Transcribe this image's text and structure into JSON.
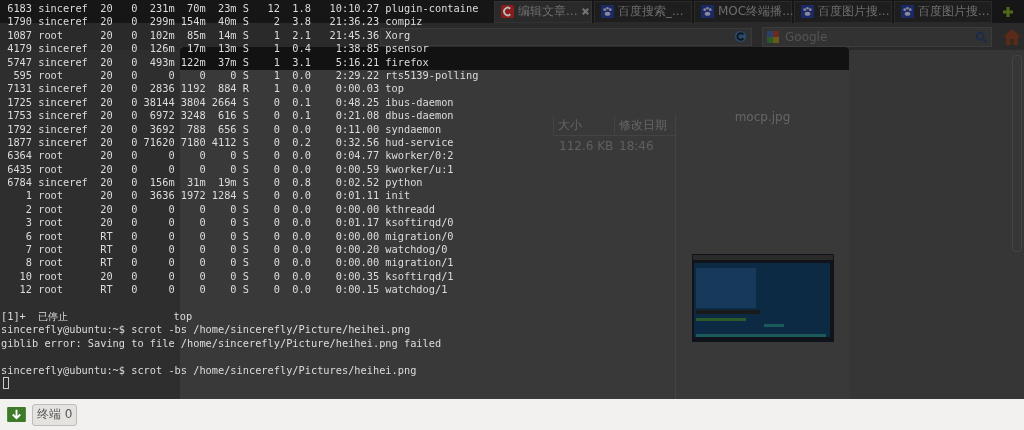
{
  "browser": {
    "tabs": [
      {
        "label": "编辑文章...",
        "kind": "arc",
        "selected": true
      },
      {
        "label": "百度搜索_...",
        "kind": "paw",
        "selected": false
      },
      {
        "label": "MOC终端播...",
        "kind": "paw",
        "selected": false
      },
      {
        "label": "百度图片搜...",
        "kind": "paw",
        "selected": false
      },
      {
        "label": "百度图片搜...",
        "kind": "paw",
        "selected": false
      }
    ],
    "search": {
      "placeholder": "Google"
    }
  },
  "file_manager": {
    "columns": [
      "大小",
      "修改日期"
    ],
    "row": [
      "112.6 KB",
      "18:46"
    ],
    "preview": {
      "title": "mocp.jpg"
    }
  },
  "terminal": {
    "process_rows": [
      " 6183 sinceref  20   0  231m  70m  23m S   12  1.8   10:10.27 plugin-containe",
      " 1790 sinceref  20   0  299m 154m  40m S    2  3.8   21:36.23 compiz",
      " 1087 root      20   0  102m  85m  14m S    1  2.1   21:45.36 Xorg",
      " 4179 sinceref  20   0  126m  17m  13m S    1  0.4    1:38.85 psensor",
      " 5747 sinceref  20   0  493m 122m  37m S    1  3.1    5:16.21 firefox",
      "  595 root      20   0     0    0    0 S    1  0.0    2:29.22 rts5139-polling",
      " 7131 sinceref  20   0  2836 1192  884 R    1  0.0    0:00.03 top",
      " 1725 sinceref  20   0 38144 3804 2664 S    0  0.1    0:48.25 ibus-daemon",
      " 1753 sinceref  20   0  6972 3248  616 S    0  0.1    0:21.08 dbus-daemon",
      " 1792 sinceref  20   0  3692  788  656 S    0  0.0    0:11.00 syndaemon",
      " 1877 sinceref  20   0 71620 7180 4112 S    0  0.2    0:32.56 hud-service",
      " 6364 root      20   0     0    0    0 S    0  0.0    0:04.77 kworker/0:2",
      " 6435 root      20   0     0    0    0 S    0  0.0    0:00.59 kworker/u:1",
      " 6784 sinceref  20   0  156m  31m  19m S    0  0.8    0:02.52 python",
      "    1 root      20   0  3636 1972 1284 S    0  0.0    0:01.11 init",
      "    2 root      20   0     0    0    0 S    0  0.0    0:00.00 kthreadd",
      "    3 root      20   0     0    0    0 S    0  0.0    0:01.17 ksoftirqd/0",
      "    6 root      RT   0     0    0    0 S    0  0.0    0:00.00 migration/0",
      "    7 root      RT   0     0    0    0 S    0  0.0    0:00.20 watchdog/0",
      "    8 root      RT   0     0    0    0 S    0  0.0    0:00.00 migration/1",
      "   10 root      20   0     0    0    0 S    0  0.0    0:00.35 ksoftirqd/1",
      "   12 root      RT   0     0    0    0 S    0  0.0    0:00.15 watchdog/1"
    ],
    "output_blocks": [
      [
        "[1]+  已停止                 top",
        "sincerefly@ubuntu:~$ scrot -bs /home/sincerefly/Picture/heihei.png",
        "giblib error: Saving to file /home/sincerefly/Picture/heihei.png failed"
      ],
      [
        "sincerefly@ubuntu:~$ scrot -bs /home/sincerefly/Pictures/heihei.png"
      ]
    ]
  },
  "taskbar": {
    "button": "终端 0"
  }
}
